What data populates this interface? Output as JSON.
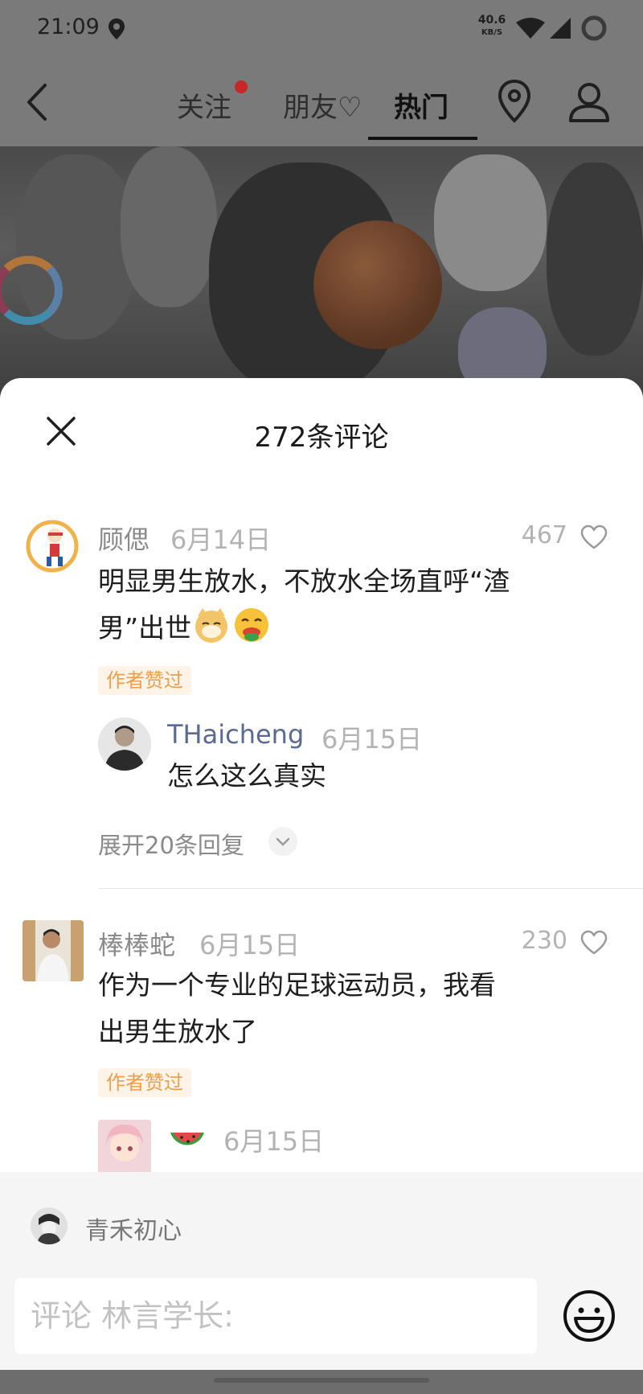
{
  "status_bar": {
    "time": "21:09",
    "net_speed_value": "40.6",
    "net_speed_unit": "KB/S",
    "icons": [
      "location-pin-icon",
      "wifi-icon",
      "cellular-signal-icon",
      "battery-ring-icon"
    ]
  },
  "nav": {
    "tabs": [
      {
        "label": "关注",
        "has_dot": true
      },
      {
        "label": "朋友♡"
      },
      {
        "label": "热门",
        "active": true
      }
    ],
    "icons": [
      "back-arrow-icon",
      "location-icon",
      "profile-icon"
    ]
  },
  "comments_sheet": {
    "title": "272条评论",
    "comments": [
      {
        "name": "顾偲",
        "date": "6月14日",
        "likes": "467",
        "text": "明显男生放水，不放水全场直呼“渣男”出世",
        "text_line1": "明显男生放水，不放水全场直呼“渣",
        "text_line2": "男”出世",
        "emojis": [
          "doge-cat-emoji",
          "drooling-face-emoji"
        ],
        "badge": "作者赞过",
        "reply": {
          "name": "THaicheng",
          "date": "6月15日",
          "text": "怎么这么真实"
        },
        "expand_label": "展开20条回复"
      },
      {
        "name": "棒棒蛇",
        "date": "6月15日",
        "likes": "230",
        "text_line1": "作为一个专业的足球运动员，我看",
        "text_line2": "出男生放水了",
        "badge": "作者赞过",
        "reply": {
          "name_emoji": "watermelon-emoji",
          "date": "6月15日"
        }
      }
    ]
  },
  "composer": {
    "at_user": "青禾初心",
    "placeholder": "评论 林言学长:",
    "emoji_button_icon": "smiley-face-icon"
  },
  "colors": {
    "accent_link": "#5a6a91",
    "badge_text": "#e8a050",
    "badge_bg": "#fdf3e6",
    "notification_dot": "#c62828"
  }
}
